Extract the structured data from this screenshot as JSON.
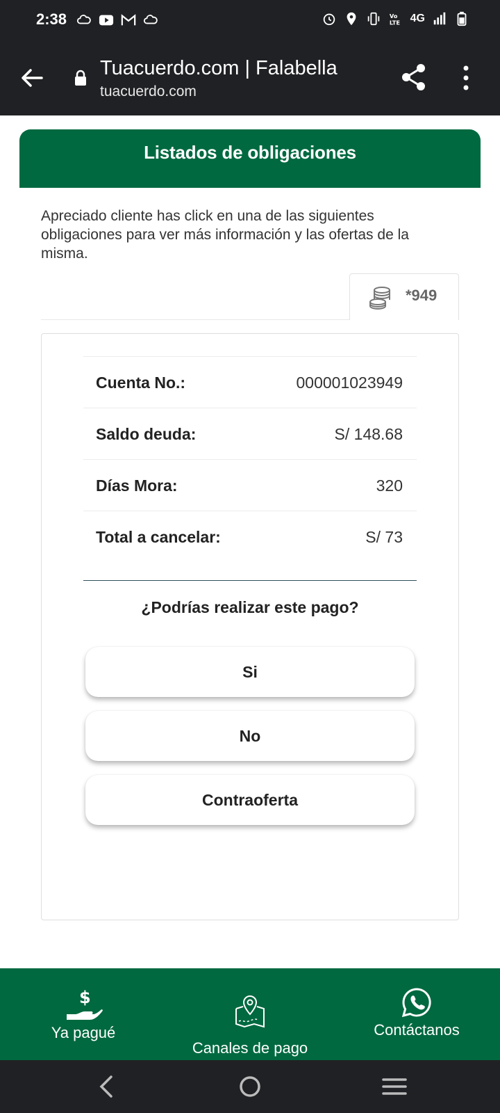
{
  "status_bar": {
    "time": "2:38",
    "network": "4G",
    "icons_left": [
      "cloud-sync-icon",
      "youtube-icon",
      "gmail-icon",
      "cloud-sync-icon"
    ],
    "icons_right": [
      "alarm-icon",
      "location-icon",
      "vibrate-icon",
      "volte-icon",
      "signal-icon",
      "battery-icon"
    ]
  },
  "browser": {
    "title": "Tuacuerdo.com | Falabella",
    "host": "tuacuerdo.com"
  },
  "header": {
    "title": "Listados de obligaciones"
  },
  "intro": "Apreciado cliente has click en una de las siguientes obligaciones para ver más información y las ofertas de la misma.",
  "account_tab": {
    "label": "*949"
  },
  "details": [
    {
      "label": "Cuenta No.:",
      "value": "000001023949"
    },
    {
      "label": "Saldo deuda:",
      "value": "S/ 148.68"
    },
    {
      "label": "Días Mora:",
      "value": "320"
    },
    {
      "label": "Total a cancelar:",
      "value": "S/ 73"
    }
  ],
  "question": "¿Podrías realizar este pago?",
  "answers": {
    "yes": "Si",
    "no": "No",
    "counter": "Contraoferta"
  },
  "bottom_nav": {
    "paid": "Ya pagué",
    "channels": "Canales de pago",
    "contact": "Contáctanos"
  },
  "colors": {
    "brand_green": "#006940",
    "system_bar": "#202124"
  }
}
